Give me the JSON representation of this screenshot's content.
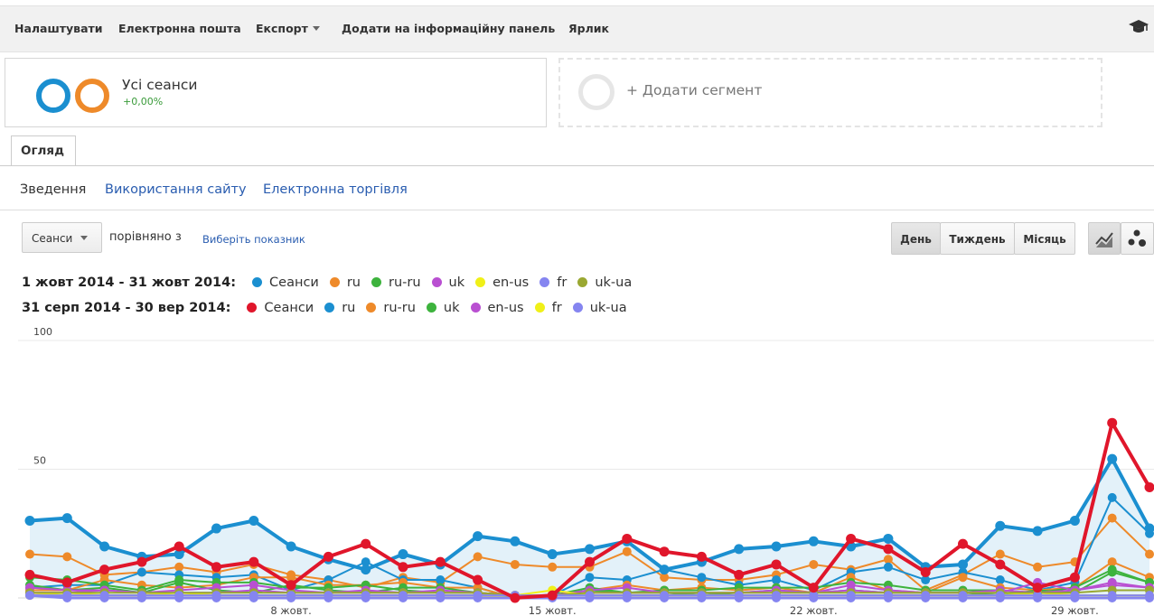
{
  "toolbar": {
    "items": [
      "Налаштувати",
      "Електронна пошта",
      "Експорт",
      "Додати на інформаційну панель",
      "Ярлик"
    ]
  },
  "segments": {
    "primary_name": "Усі сеанси",
    "primary_change": "+0,00%",
    "add_label": "+ Додати сегмент"
  },
  "tabs": {
    "overview": "Огляд"
  },
  "subnav": [
    "Зведення",
    "Використання сайту",
    "Електронна торгівля"
  ],
  "controls": {
    "metric": "Сеанси",
    "compare_text": "порівняно з",
    "compare_link": "Виберіть показник",
    "periods": [
      "День",
      "Тиждень",
      "Місяць"
    ],
    "active_period": "День"
  },
  "legend": {
    "row1_range": "1 жовт 2014 - 31 жовт 2014:",
    "row2_range": "31 серп 2014 - 30 вер 2014:",
    "row1": [
      {
        "label": "Сеанси",
        "color": "#1b8fd0"
      },
      {
        "label": "ru",
        "color": "#ee8a2a"
      },
      {
        "label": "ru-ru",
        "color": "#3db33d"
      },
      {
        "label": "uk",
        "color": "#b94fd1"
      },
      {
        "label": "en-us",
        "color": "#f0f018"
      },
      {
        "label": "fr",
        "color": "#8585f0"
      },
      {
        "label": "uk-ua",
        "color": "#9aa832"
      }
    ],
    "row2": [
      {
        "label": "Сеанси",
        "color": "#e0162b"
      },
      {
        "label": "ru",
        "color": "#1b8fd0"
      },
      {
        "label": "ru-ru",
        "color": "#ee8a2a"
      },
      {
        "label": "uk",
        "color": "#3db33d"
      },
      {
        "label": "en-us",
        "color": "#b94fd1"
      },
      {
        "label": "fr",
        "color": "#f0f018"
      },
      {
        "label": "uk-ua",
        "color": "#8585f0"
      }
    ]
  },
  "chart_data": {
    "type": "line",
    "ylim": [
      0,
      100
    ],
    "y_ticks": [
      "100",
      "50"
    ],
    "x_ticks": [
      "8 жовт.",
      "15 жовт.",
      "22 жовт.",
      "29 жовт."
    ],
    "x_tick_days": [
      8,
      15,
      22,
      29
    ],
    "days": [
      1,
      2,
      3,
      4,
      5,
      6,
      7,
      8,
      9,
      10,
      11,
      12,
      13,
      14,
      15,
      16,
      17,
      18,
      19,
      20,
      21,
      22,
      23,
      24,
      25,
      26,
      27,
      28,
      29,
      30,
      31
    ],
    "series": [
      {
        "name": "Сеанси",
        "period": "1 жовт 2014 - 31 жовт 2014",
        "color": "#1b8fd0",
        "width": 4,
        "area": true,
        "values": [
          30,
          31,
          20,
          16,
          17,
          27,
          30,
          20,
          15,
          11,
          17,
          13,
          24,
          22,
          17,
          19,
          22,
          11,
          14,
          19,
          20,
          22,
          20,
          23,
          12,
          13,
          28,
          26,
          30,
          54,
          27
        ]
      },
      {
        "name": "Сеанси",
        "period": "31 серп 2014 - 30 вер 2014",
        "color": "#e0162b",
        "width": 4,
        "values": [
          9,
          6,
          11,
          14,
          20,
          12,
          14,
          5,
          16,
          21,
          12,
          14,
          7,
          0,
          1,
          14,
          23,
          18,
          16,
          9,
          13,
          4,
          23,
          19,
          10,
          21,
          13,
          4,
          8,
          68,
          43
        ]
      },
      {
        "name": "ru",
        "period": "1 жовт 2014 - 31 жовт 2014",
        "color": "#ee8a2a",
        "width": 2,
        "values": [
          17,
          16,
          9,
          10,
          12,
          10,
          13,
          9,
          7,
          4,
          8,
          6,
          16,
          13,
          12,
          12,
          18,
          8,
          7,
          7,
          9,
          13,
          11,
          15,
          3,
          9,
          17,
          12,
          14,
          31,
          17
        ]
      },
      {
        "name": "ru",
        "period": "31 серп 2014 - 30 вер 2014",
        "color": "#1b8fd0",
        "width": 2,
        "values": [
          4,
          5,
          5,
          10,
          9,
          8,
          9,
          3,
          7,
          14,
          7,
          7,
          4,
          0,
          1,
          8,
          7,
          11,
          8,
          5,
          7,
          3,
          10,
          12,
          7,
          10,
          7,
          3,
          6,
          39,
          25
        ]
      },
      {
        "name": "ru-ru",
        "period": "31 серп 2014 - 30 вер 2014",
        "color": "#ee8a2a",
        "width": 2,
        "values": [
          3,
          3,
          7,
          5,
          4,
          5,
          8,
          8,
          5,
          5,
          6,
          4,
          4,
          0,
          1,
          3,
          5,
          3,
          4,
          3,
          4,
          2,
          8,
          3,
          2,
          8,
          4,
          3,
          4,
          14,
          8
        ]
      },
      {
        "name": "ru-ru",
        "period": "1 жовт 2014 - 31 жовт 2014",
        "color": "#3db33d",
        "width": 2,
        "values": [
          8,
          7,
          5,
          3,
          7,
          6,
          6,
          4,
          4,
          5,
          3,
          2,
          2,
          1,
          1,
          4,
          2,
          3,
          3,
          4,
          4,
          4,
          6,
          5,
          3,
          3,
          3,
          2,
          4,
          11,
          6
        ]
      },
      {
        "name": "uk",
        "period": "31 серп 2014 - 30 вер 2014",
        "color": "#3db33d",
        "width": 2,
        "values": [
          5,
          3,
          4,
          2,
          6,
          3,
          2,
          5,
          3,
          2,
          4,
          4,
          2,
          0,
          1,
          3,
          2,
          2,
          1,
          2,
          3,
          2,
          3,
          2,
          2,
          2,
          1,
          3,
          2,
          10,
          6
        ]
      },
      {
        "name": "uk",
        "period": "1 жовт 2014 - 31 жовт 2014",
        "color": "#b94fd1",
        "width": 2,
        "values": [
          4,
          3,
          3,
          2,
          3,
          4,
          5,
          3,
          2,
          3,
          2,
          3,
          2,
          1,
          1,
          3,
          4,
          2,
          2,
          2,
          3,
          2,
          5,
          3,
          2,
          2,
          3,
          2,
          3,
          5,
          4
        ]
      },
      {
        "name": "en-us",
        "period": "31 серп 2014 - 30 вер 2014",
        "color": "#b94fd1",
        "width": 2,
        "values": [
          2,
          2,
          3,
          2,
          2,
          2,
          3,
          2,
          2,
          2,
          2,
          2,
          2,
          1,
          1,
          2,
          2,
          2,
          2,
          2,
          2,
          2,
          3,
          2,
          2,
          2,
          2,
          6,
          3,
          6,
          4
        ]
      },
      {
        "name": "en-us",
        "period": "1 жовт 2014 - 31 жовт 2014",
        "color": "#f0f018",
        "width": 2,
        "values": [
          1,
          2,
          1,
          1,
          2,
          1,
          1,
          1,
          1,
          1,
          1,
          1,
          1,
          1,
          3,
          1,
          1,
          1,
          1,
          1,
          1,
          1,
          1,
          1,
          1,
          1,
          1,
          2,
          1,
          1,
          1
        ]
      },
      {
        "name": "fr",
        "period": "31 серп 2014 - 30 вер 2014",
        "color": "#f0f018",
        "width": 2,
        "values": [
          1,
          1,
          1,
          1,
          1,
          1,
          1,
          1,
          1,
          1,
          1,
          1,
          1,
          0,
          1,
          1,
          1,
          1,
          1,
          1,
          1,
          1,
          1,
          1,
          1,
          1,
          1,
          1,
          1,
          1,
          1
        ]
      },
      {
        "name": "uk-ua",
        "period": "1 жовт 2014 - 31 жовт 2014",
        "color": "#9aa832",
        "width": 2,
        "values": [
          2,
          2,
          2,
          2,
          2,
          2,
          2,
          2,
          2,
          2,
          2,
          2,
          2,
          1,
          1,
          2,
          2,
          2,
          2,
          2,
          2,
          2,
          2,
          2,
          2,
          2,
          2,
          2,
          2,
          3,
          3
        ]
      },
      {
        "name": "fr",
        "period": "1 жовт 2014 - 31 жовт 2014",
        "color": "#8585f0",
        "width": 2,
        "values": [
          1,
          1,
          1,
          1,
          1,
          1,
          1,
          1,
          1,
          1,
          1,
          1,
          1,
          1,
          1,
          1,
          1,
          1,
          1,
          1,
          1,
          1,
          1,
          1,
          1,
          1,
          1,
          1,
          1,
          1,
          1
        ]
      },
      {
        "name": "uk-ua",
        "period": "31 серп 2014 - 30 вер 2014",
        "color": "#8585f0",
        "width": 3,
        "values": [
          1,
          0,
          0,
          0,
          0,
          0,
          0,
          0,
          0,
          0,
          0,
          0,
          0,
          0,
          0,
          0,
          0,
          0,
          0,
          0,
          0,
          0,
          0,
          0,
          0,
          0,
          0,
          0,
          0,
          0,
          0
        ]
      }
    ]
  }
}
